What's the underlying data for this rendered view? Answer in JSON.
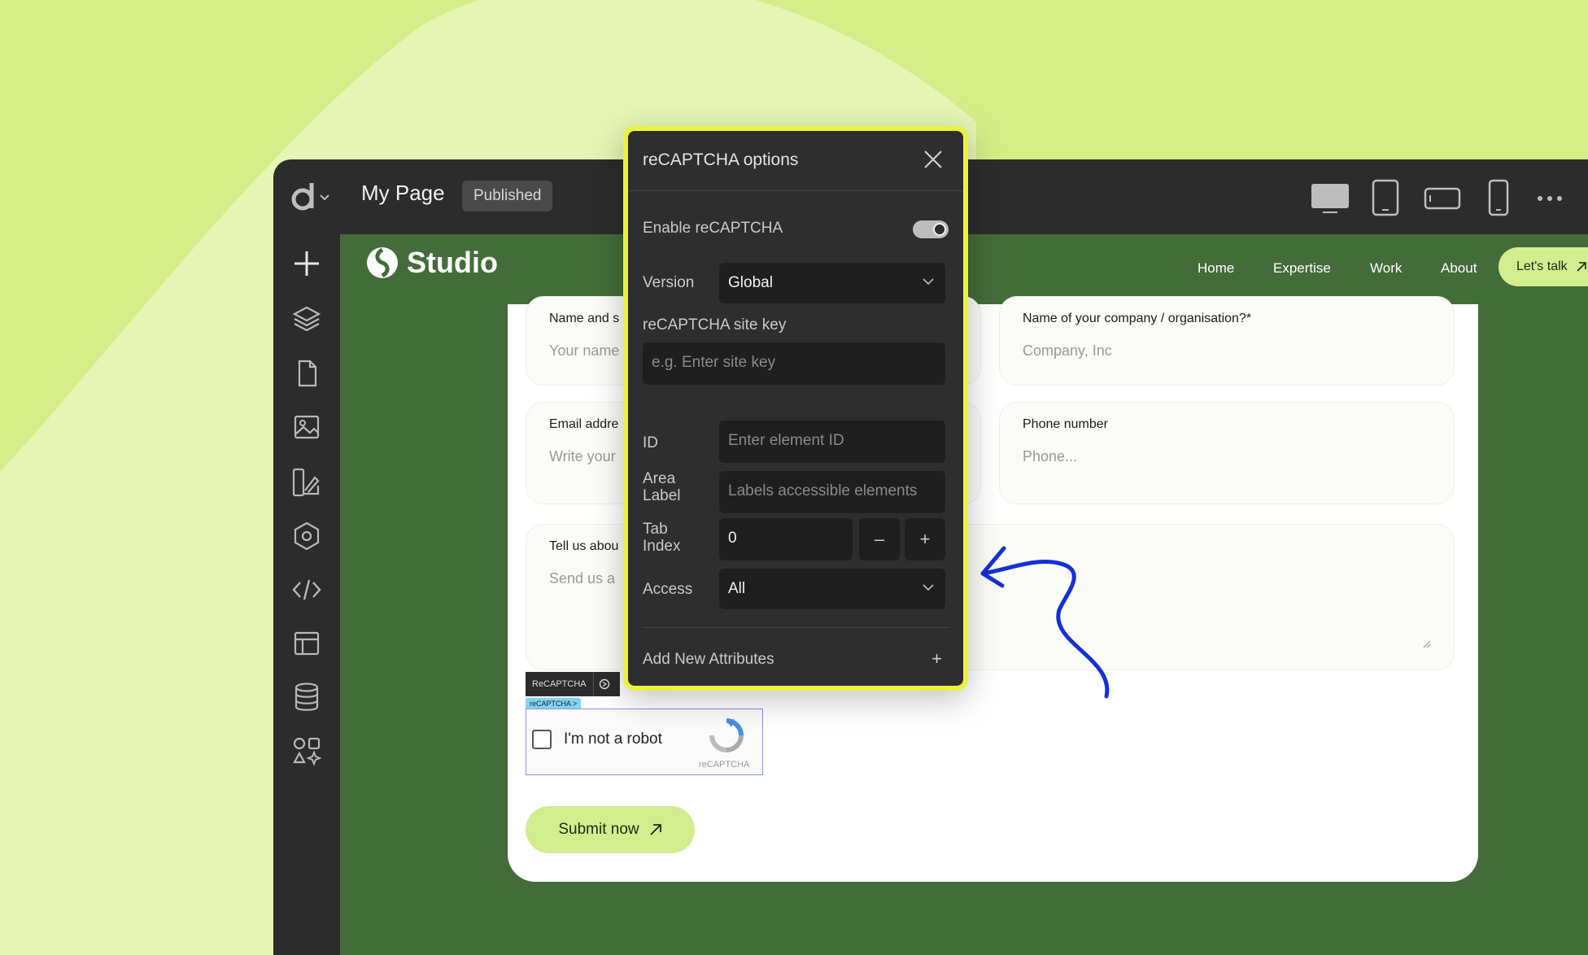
{
  "editor": {
    "page_title": "My Page",
    "status": "Published"
  },
  "site": {
    "brand": "Studio",
    "nav": [
      "Home",
      "Expertise",
      "Work",
      "About"
    ],
    "cta": "Let's talk"
  },
  "form": {
    "name_label": "Name and s",
    "name_placeholder": "Your name",
    "company_label": "Name of your company / organisation?*",
    "company_placeholder": "Company, Inc",
    "email_label": "Email addre",
    "email_placeholder": "Write your",
    "phone_label": "Phone number",
    "phone_placeholder": "Phone...",
    "message_label": "Tell us abou",
    "message_placeholder": "Send us a",
    "recaptcha_toolbar_label": "ReCAPTCHA",
    "recaptcha_tag": "reCAPTCHA >",
    "recaptcha_text": "I'm not a robot",
    "recaptcha_brand": "reCAPTCHA",
    "submit": "Submit now"
  },
  "modal": {
    "title": "reCAPTCHA options",
    "enable_label": "Enable reCAPTCHA",
    "enabled": true,
    "version_label": "Version",
    "version_value": "Global",
    "site_key_label": "reCAPTCHA site key",
    "site_key_placeholder": "e.g. Enter site key",
    "id_label": "ID",
    "id_placeholder": "Enter element ID",
    "area_label": "Area Label",
    "area_placeholder": "Labels accessible elements",
    "tab_label": "Tab Index",
    "tab_value": "0",
    "minus": "–",
    "plus": "+",
    "access_label": "Access",
    "access_value": "All",
    "add_attr_label": "Add New Attributes",
    "add_attr_plus": "+"
  },
  "colors": {
    "background": "#d6ec88",
    "editor_dark": "#2c2c2c",
    "canvas_green": "#446b3a",
    "accent_lime": "#d3ec8e",
    "modal_border": "#eaf33c",
    "arrow_blue": "#1530d8"
  }
}
